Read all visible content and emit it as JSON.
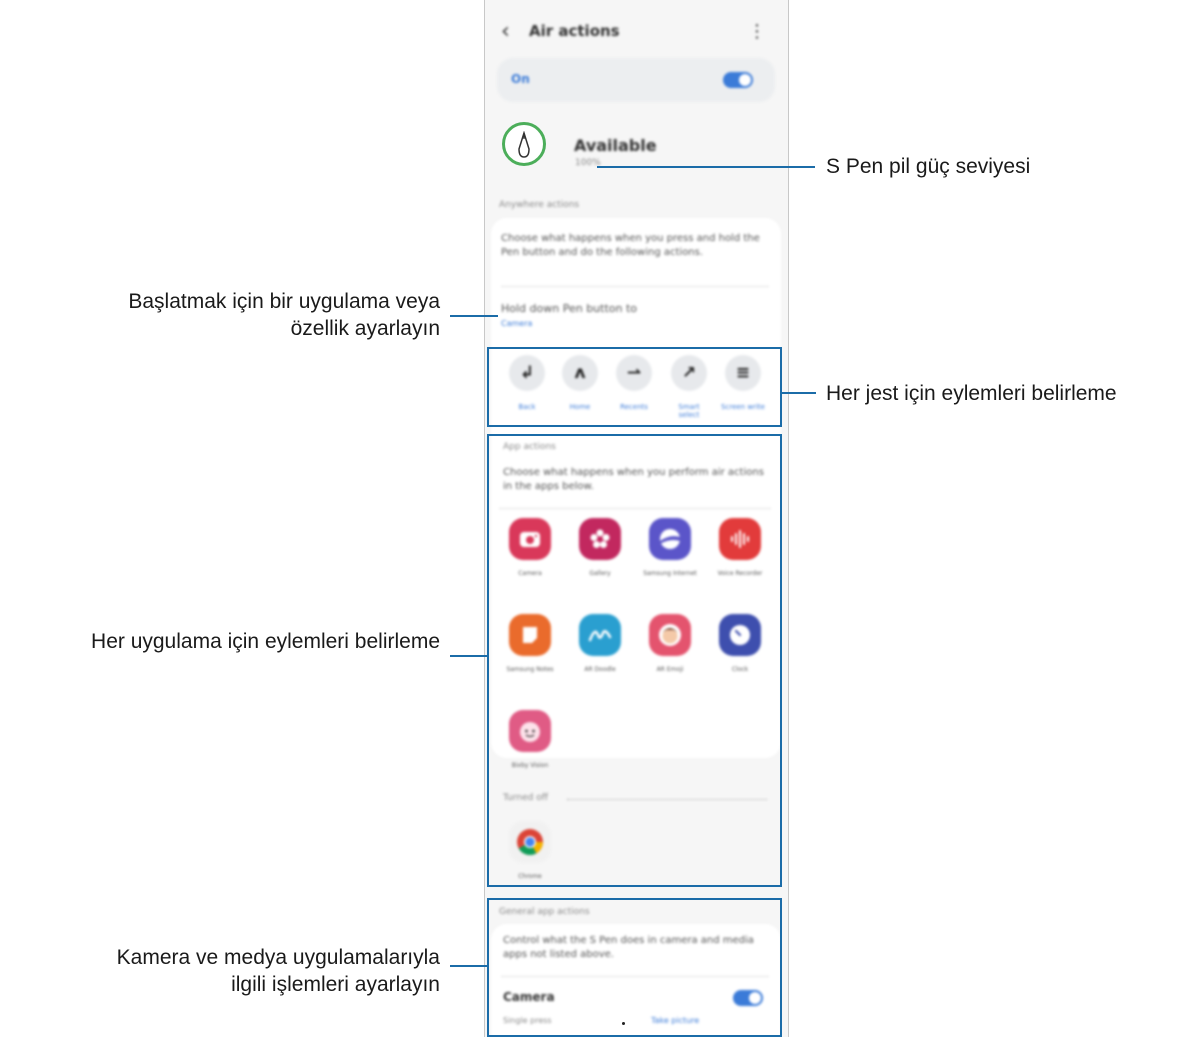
{
  "screen": {
    "title": "Air actions",
    "master_switch_label": "On",
    "master_switch_on": true,
    "battery_title": "Available",
    "battery_level": "100%",
    "anywhere_header": "Anywhere actions",
    "anywhere_desc": "Choose what happens when you press and hold the Pen button and do the following actions.",
    "hold_title": "Hold down Pen button to",
    "hold_value": "Camera",
    "gestures": [
      {
        "glyph": "↲",
        "label": "Back"
      },
      {
        "glyph": "ᴧ",
        "label": "Home"
      },
      {
        "glyph": "⇀",
        "label": "Recents"
      },
      {
        "glyph": "↗",
        "label": "Smart select"
      },
      {
        "glyph": "≡",
        "label": "Screen write"
      }
    ],
    "app_actions_header": "App actions",
    "app_actions_desc": "Choose what happens when you perform air actions in the apps below.",
    "apps": [
      {
        "name": "Camera",
        "color": "#d9385a",
        "icon": "camera-icon"
      },
      {
        "name": "Gallery",
        "color": "#c2285f",
        "icon": "gallery-icon"
      },
      {
        "name": "Samsung Internet",
        "color": "#5b55c9",
        "icon": "internet-icon"
      },
      {
        "name": "Voice Recorder",
        "color": "#e23b3b",
        "icon": "voice-recorder-icon"
      },
      {
        "name": "Samsung Notes",
        "color": "#ea6b2c",
        "icon": "notes-icon"
      },
      {
        "name": "AR Doodle",
        "color": "#2a9fd0",
        "icon": "ar-doodle-icon"
      },
      {
        "name": "AR Emoji",
        "color": "#e4546e",
        "icon": "ar-emoji-icon"
      },
      {
        "name": "Clock",
        "color": "#3e4fae",
        "icon": "clock-icon"
      },
      {
        "name": "Bixby Vision",
        "color": "#e05b85",
        "icon": "ar-kids-icon"
      }
    ],
    "turned_off_header": "Turned off",
    "off_apps": [
      {
        "name": "Chrome",
        "icon": "chrome-icon"
      }
    ],
    "general_header": "General app actions",
    "general_desc": "Control what the S Pen does in camera and media apps not listed above.",
    "camera_row_title": "Camera",
    "camera_row_on": true,
    "single_press_label": "Single press",
    "single_press_value": "Take picture"
  },
  "callouts": {
    "battery": "S Pen pil güç seviyesi",
    "hold_line1": "Başlatmak için bir uygulama veya",
    "hold_line2": "özellik ayarlayın",
    "gestures": "Her jest için eylemleri belirleme",
    "apps": "Her uygulama için eylemleri belirleme",
    "media_line1": "Kamera ve medya uygulamalarıyla",
    "media_line2": "ilgili işlemleri ayarlayın"
  },
  "colors": {
    "accent": "#3b7bd8",
    "callout_line": "#1b6ca8",
    "battery_ring": "#4cae5a"
  }
}
